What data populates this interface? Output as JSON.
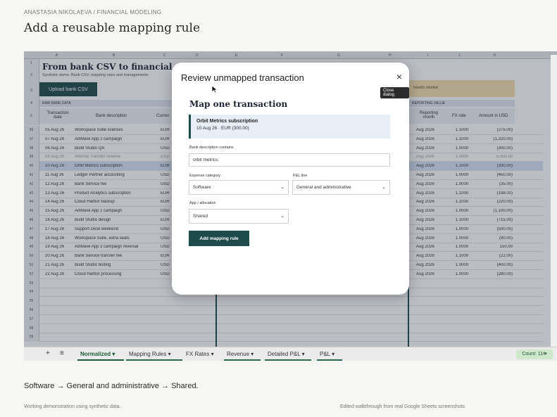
{
  "breadcrumb": {
    "text": "ANASTASIA NIKOLAEVA / FINANCIAL MODELING"
  },
  "page_title": "Add a reusable mapping rule",
  "sheet": {
    "columns": [
      "A",
      "B",
      "C",
      "D",
      "E",
      "F",
      "G",
      "H",
      "I",
      "J",
      "K"
    ],
    "title": "From bank CSV to financial reportin",
    "subtitle": "Synthetic demo. Bank CSV, mapping rules and managements",
    "upload_button": "Upload bank CSV",
    "needs_review": "needs review",
    "raw_band": "RAW BANK DATA",
    "reporting_band": "REPORTING VALUE",
    "headers": {
      "date": "Transaction date",
      "desc": "Bank description",
      "currency": "Curren",
      "month": "Reporting month",
      "fx": "FX rate",
      "amount": "Amount in USD"
    },
    "header_row_nums": [
      "1",
      "2",
      "3",
      "4",
      "5"
    ],
    "rows": [
      {
        "n": "36",
        "date": "05 Aug 26",
        "desc": "Workspace Suite licenses",
        "cur": "EUR",
        "month": "Aug 2026",
        "fx": "1.1000",
        "amt": "(275.00)"
      },
      {
        "n": "37",
        "date": "07 Aug 26",
        "desc": "AdWave App 2 campaign",
        "cur": "EUR",
        "month": "Aug 2026",
        "fx": "1.1000",
        "amt": "(1,320.00)"
      },
      {
        "n": "38",
        "date": "08 Aug 26",
        "desc": "Build Studio QA",
        "cur": "USD",
        "month": "Aug 2026",
        "fx": "1.0000",
        "amt": "(300.00)"
      },
      {
        "n": "39",
        "date": "09 Aug 26",
        "desc": "Internal Transfer reserve",
        "cur": "USD",
        "month": "Aug 2026",
        "fx": "1.0000",
        "amt": "5,000.00"
      },
      {
        "n": "40",
        "date": "10 Aug 26",
        "desc": "Orbit Metrics subscription",
        "cur": "EUR",
        "month": "Aug 2026",
        "fx": "1.1000",
        "amt": "(330.00)"
      },
      {
        "n": "41",
        "date": "11 Aug 26",
        "desc": "Ledger Partner accounting",
        "cur": "USD",
        "month": "Aug 2026",
        "fx": "1.0000",
        "amt": "(450.00)"
      },
      {
        "n": "42",
        "date": "12 Aug 26",
        "desc": "Bank Service fee",
        "cur": "USD",
        "month": "Aug 2026",
        "fx": "1.0000",
        "amt": "(35.00)"
      },
      {
        "n": "43",
        "date": "13 Aug 26",
        "desc": "Product Analytics subscription",
        "cur": "EUR",
        "month": "Aug 2026",
        "fx": "1.1000",
        "amt": "(198.00)"
      },
      {
        "n": "44",
        "date": "14 Aug 26",
        "desc": "Cloud Harbor backup",
        "cur": "EUR",
        "month": "Aug 2026",
        "fx": "1.1000",
        "amt": "(220.00)"
      },
      {
        "n": "45",
        "date": "15 Aug 26",
        "desc": "AdWave App 1 campaign",
        "cur": "USD",
        "month": "Aug 2026",
        "fx": "1.0000",
        "amt": "(1,100.00)"
      },
      {
        "n": "46",
        "date": "16 Aug 26",
        "desc": "Build Studio design",
        "cur": "EUR",
        "month": "Aug 2026",
        "fx": "1.1000",
        "amt": "(715.00)"
      },
      {
        "n": "47",
        "date": "17 Aug 26",
        "desc": "Support Desk weekend",
        "cur": "USD",
        "month": "Aug 2026",
        "fx": "1.0000",
        "amt": "(500.00)"
      },
      {
        "n": "48",
        "date": "18 Aug 26",
        "desc": "Workspace Suite, extra seats",
        "cur": "USD",
        "month": "Aug 2026",
        "fx": "1.0000",
        "amt": "(90.00)"
      },
      {
        "n": "49",
        "date": "19 Aug 26",
        "desc": "AdWave App 2 campaign reversal",
        "cur": "USD",
        "month": "Aug 2026",
        "fx": "1.0000",
        "amt": "150.00"
      },
      {
        "n": "50",
        "date": "20 Aug 26",
        "desc": "Bank Service transfer fee",
        "cur": "EUR",
        "month": "Aug 2026",
        "fx": "1.1000",
        "amt": "(22.00)"
      },
      {
        "n": "51",
        "date": "21 Aug 26",
        "desc": "Build Studio testing",
        "cur": "USD",
        "month": "Aug 2026",
        "fx": "1.0000",
        "amt": "(400.00)"
      },
      {
        "n": "52",
        "date": "22 Aug 26",
        "desc": "Cloud Harbor processing",
        "cur": "USD",
        "month": "Aug 2026",
        "fx": "1.0000",
        "amt": "(280.00)"
      }
    ],
    "empty_rows": [
      "53",
      "54",
      "55",
      "56",
      "57",
      "58",
      "59"
    ]
  },
  "tabs": {
    "add": "+",
    "menu": "≡",
    "items": [
      {
        "label": "Normalized",
        "arrow": "▾"
      },
      {
        "label": "Mapping Rules",
        "arrow": "▾"
      },
      {
        "label": "FX Rates",
        "arrow": "▾"
      },
      {
        "label": "Revenue",
        "arrow": "▾"
      },
      {
        "label": "Detailed P&L",
        "arrow": "▾"
      },
      {
        "label": "P&L",
        "arrow": "▾"
      }
    ],
    "count": "Count: 11 ▾",
    "nav": "‹"
  },
  "modal": {
    "title": "Review unmapped transaction",
    "close": "×",
    "close_tooltip": "Close dialog",
    "heading": "Map one transaction",
    "txn_name": "Orbit Metrics subscription",
    "txn_detail": "10 Aug 26 · EUR (300.00)",
    "desc_label": "Bank description contains",
    "desc_value": "orbit metrics",
    "expense_label": "Expense category",
    "expense_value": "Software",
    "pl_label": "P&L line",
    "pl_value": "General and administrative",
    "app_label": "App / allocation",
    "app_value": "Shared",
    "submit": "Add mapping rule"
  },
  "caption": "Software → General and administrative → Shared.",
  "footer": {
    "left": "Working demonstration using synthetic data.",
    "right": "Edited walkthrough from real Google Sheets screenshots"
  },
  "colors": {
    "accent": "#1e4a4a",
    "tab_active": "#1e5a3a"
  }
}
